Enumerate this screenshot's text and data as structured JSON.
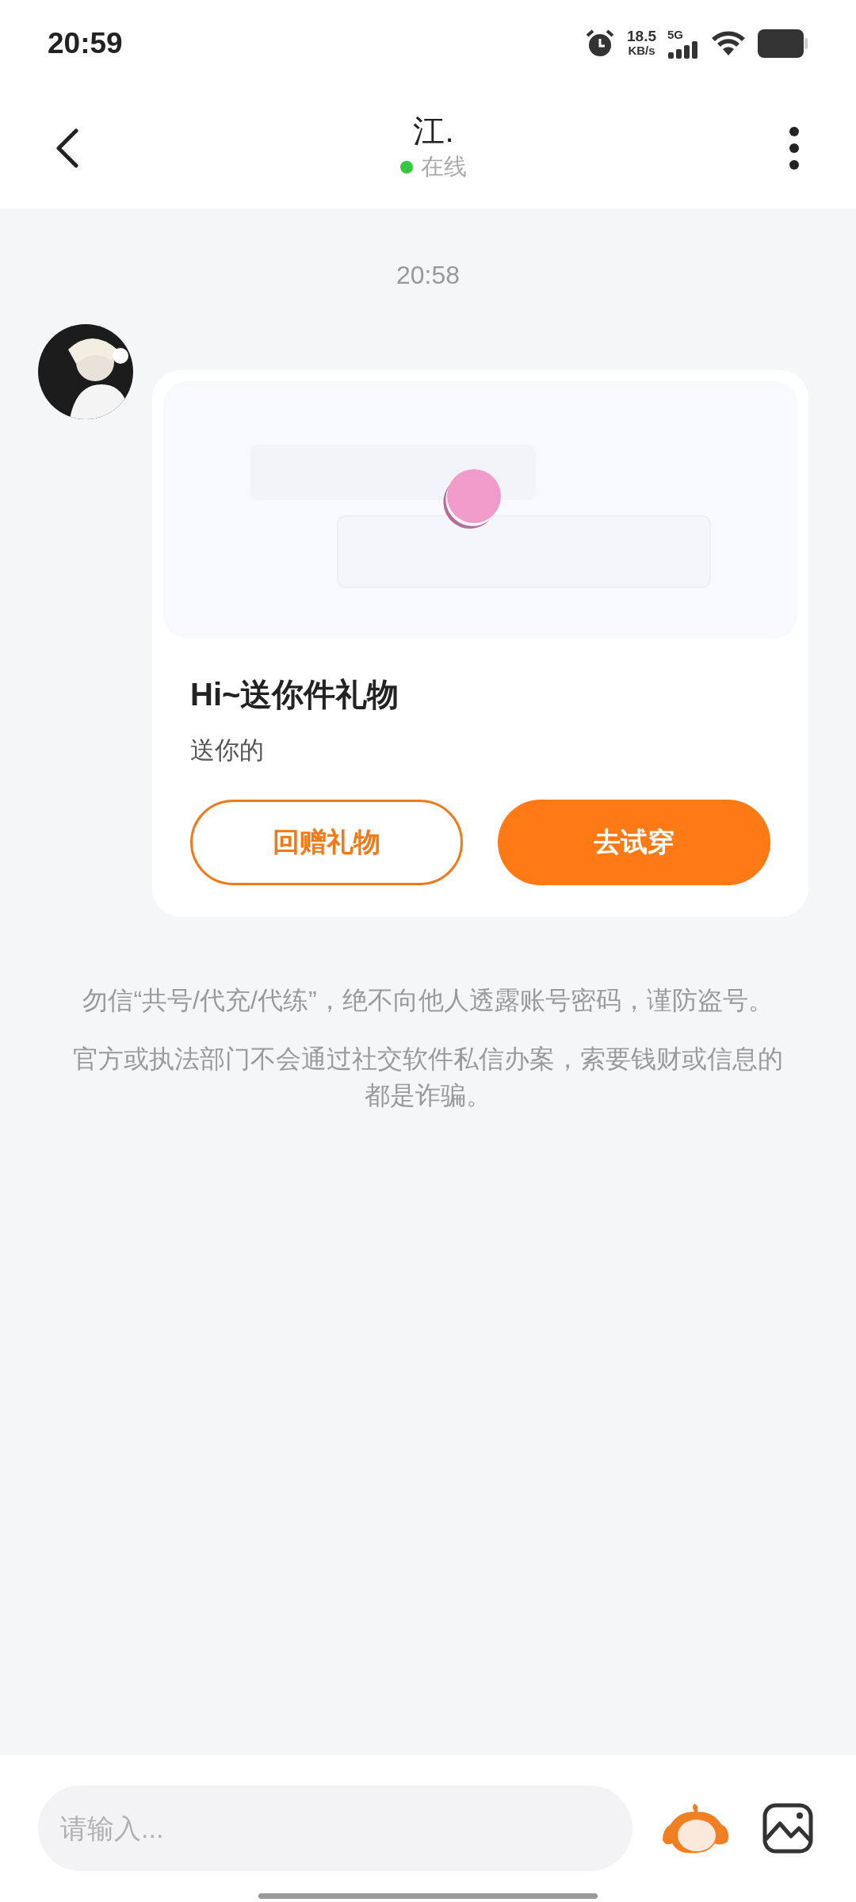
{
  "status_bar": {
    "time": "20:59",
    "speed_value": "18.5",
    "speed_unit": "KB/s",
    "network": "5G"
  },
  "header": {
    "title": "江.",
    "presence": {
      "label": "在线",
      "online": true
    }
  },
  "messages": [
    {
      "kind": "time",
      "text": "20:58"
    },
    {
      "kind": "gift_card",
      "title": "Hi~送你件礼物",
      "subtitle": "送你的",
      "buttons": [
        {
          "label": "回赠礼物",
          "kind": "outline"
        },
        {
          "label": "去试穿",
          "kind": "filled"
        }
      ]
    }
  ],
  "notices": [
    "勿信“共号/代充/代练”，绝不向他人透露账号密码，谨防盗号。",
    "官方或执法部门不会通过社交软件私信办案，索要钱财或信息的都是诈骗。"
  ],
  "composer": {
    "placeholder": "请输入..."
  }
}
